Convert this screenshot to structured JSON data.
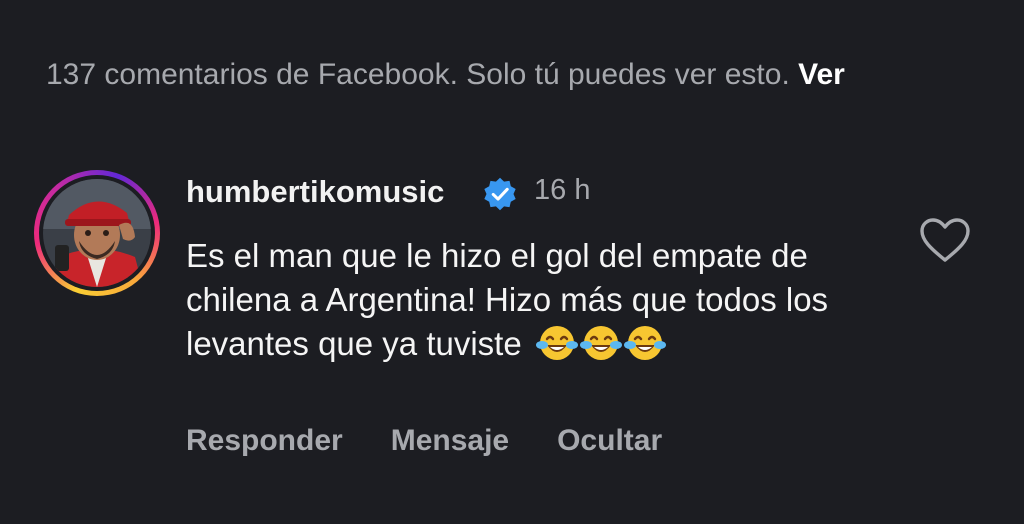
{
  "notice": {
    "text": "137 comentarios de Facebook. Solo tú puedes ver esto.",
    "link": "Ver"
  },
  "comment": {
    "username": "humbertikomusic",
    "verified_icon": "verified-badge-icon",
    "time": "16 h",
    "text": "Es el man que le hizo el gol del empate de chilena a Argentina! Hizo más que todos los levantes que ya tuviste",
    "emoji_icon": "face-with-tears-of-joy-emoji",
    "like_icon": "heart-outline-icon"
  },
  "actions": {
    "reply": "Responder",
    "message": "Mensaje",
    "hide": "Ocultar"
  },
  "colors": {
    "background": "#1c1d22",
    "muted_text": "#a7a9ae",
    "primary_text": "#f5f5f5",
    "verified_blue": "#3897f0"
  }
}
